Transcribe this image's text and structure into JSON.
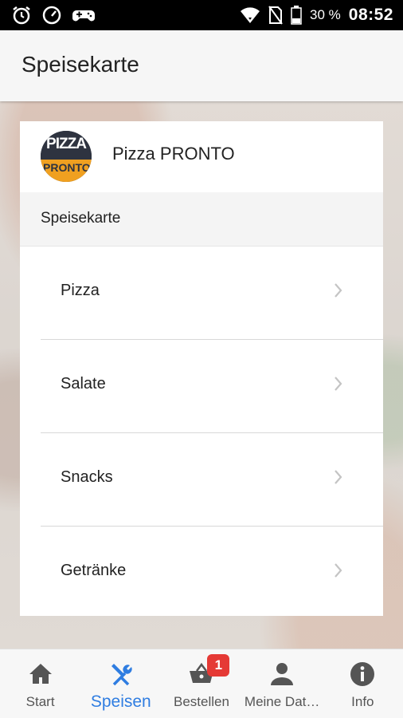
{
  "status_bar": {
    "battery_percent": "30 %",
    "time": "08:52",
    "icons": [
      "alarm-icon",
      "speed-icon",
      "gamepad-icon",
      "wifi-icon",
      "no-sim-icon",
      "battery-icon"
    ]
  },
  "app_bar": {
    "title": "Speisekarte"
  },
  "restaurant": {
    "name": "Pizza PRONTO",
    "logo_text_top": "PIZZA",
    "logo_text_bottom": "PRONTO"
  },
  "menu": {
    "section_title": "Speisekarte",
    "items": [
      {
        "label": "Pizza"
      },
      {
        "label": "Salate"
      },
      {
        "label": "Snacks"
      },
      {
        "label": "Getränke"
      }
    ]
  },
  "bottom_nav": {
    "items": [
      {
        "label": "Start",
        "icon": "home-icon"
      },
      {
        "label": "Speisen",
        "icon": "cutlery-icon",
        "active": true
      },
      {
        "label": "Bestellen",
        "icon": "basket-icon",
        "badge": "1"
      },
      {
        "label": "Meine Dat…",
        "icon": "person-icon"
      },
      {
        "label": "Info",
        "icon": "info-icon"
      }
    ]
  },
  "colors": {
    "accent": "#2f7de1",
    "badge": "#e53935",
    "status_bar": "#000000",
    "app_bar": "#f6f6f6"
  }
}
